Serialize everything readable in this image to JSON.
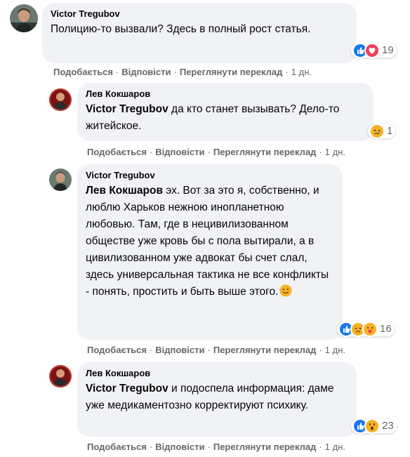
{
  "comments": [
    {
      "author": "Victor Tregubov",
      "mention": "",
      "text": "Полицию-то вызвали? Здесь в полный рост статья.",
      "reaction_count": "19",
      "reactions": [
        "like",
        "love"
      ],
      "actions": {
        "like": "Подобається",
        "reply": "Відповісти",
        "translate": "Переглянути переклад",
        "time": "1 дн."
      }
    },
    {
      "author": "Лев Кокшаров",
      "mention": "Victor Tregubov",
      "text": " да кто станет вызывать? Дело-то житейское.",
      "reaction_count": "1",
      "reactions": [
        "sad"
      ],
      "actions": {
        "like": "Подобається",
        "reply": "Відповісти",
        "translate": "Переглянути переклад",
        "time": "1 дн."
      }
    },
    {
      "author": "Victor Tregubov",
      "mention": "Лев Кокшаров",
      "text": " эх. Вот за это я, собственно, и люблю Харьков нежною инопланетною любовью. Там, где в нецивилизованном обществе уже кровь бы с пола вытирали, а в цивилизованном уже адвокат бы счет слал, здесь универсальная тактика не все конфликты - понять, простить и быть выше этого.",
      "reaction_count": "16",
      "reactions": [
        "like",
        "sad",
        "care"
      ],
      "actions": {
        "like": "Подобається",
        "reply": "Відповісти",
        "translate": "Переглянути переклад",
        "time": "1 дн."
      }
    },
    {
      "author": "Лев Кокшаров",
      "mention": "Victor Tregubov",
      "text": " и подоспела информация: даме уже медикаментозно корректируют психику.",
      "reaction_count": "23",
      "reactions": [
        "like",
        "wow"
      ],
      "actions": {
        "like": "Подобається",
        "reply": "Відповісти",
        "translate": "Переглянути переклад",
        "time": "1 дн."
      }
    }
  ],
  "colors": {
    "bubble": "#f0f2f5",
    "like": "#1877f2",
    "love": "#f33e58",
    "emoji_yellow": "#f7b125",
    "secondary_text": "#65676b"
  }
}
